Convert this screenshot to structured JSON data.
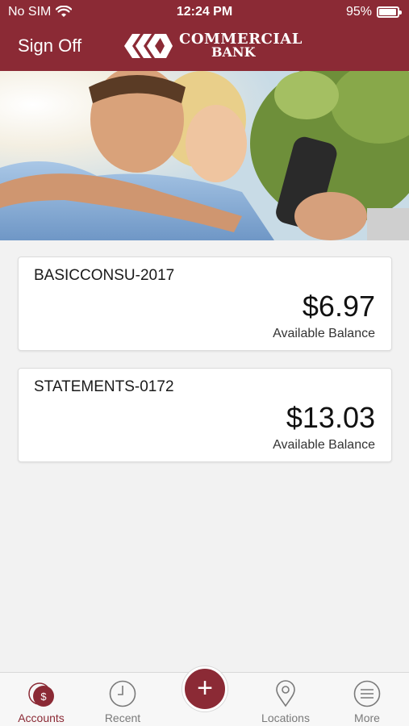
{
  "status": {
    "carrier": "No SIM",
    "time": "12:24 PM",
    "battery": "95%",
    "battery_level": 0.95
  },
  "header": {
    "sign_off": "Sign Off",
    "logo_line1": "COMMERCIAL",
    "logo_line2": "BANK"
  },
  "accounts": [
    {
      "name": "BASICCONSU-2017",
      "amount": "$6.97",
      "label": "Available Balance"
    },
    {
      "name": "STATEMENTS-0172",
      "amount": "$13.03",
      "label": "Available Balance"
    }
  ],
  "tabs": [
    {
      "label": "Accounts",
      "icon": "dollar-icon",
      "active": true
    },
    {
      "label": "Recent",
      "icon": "clock-icon",
      "active": false
    },
    {
      "label": "Locations",
      "icon": "location-pin-icon",
      "active": false
    },
    {
      "label": "More",
      "icon": "menu-icon",
      "active": false
    }
  ],
  "fab": {
    "symbol": "+"
  },
  "colors": {
    "brand": "#8b2a35",
    "background": "#f2f2f2"
  }
}
